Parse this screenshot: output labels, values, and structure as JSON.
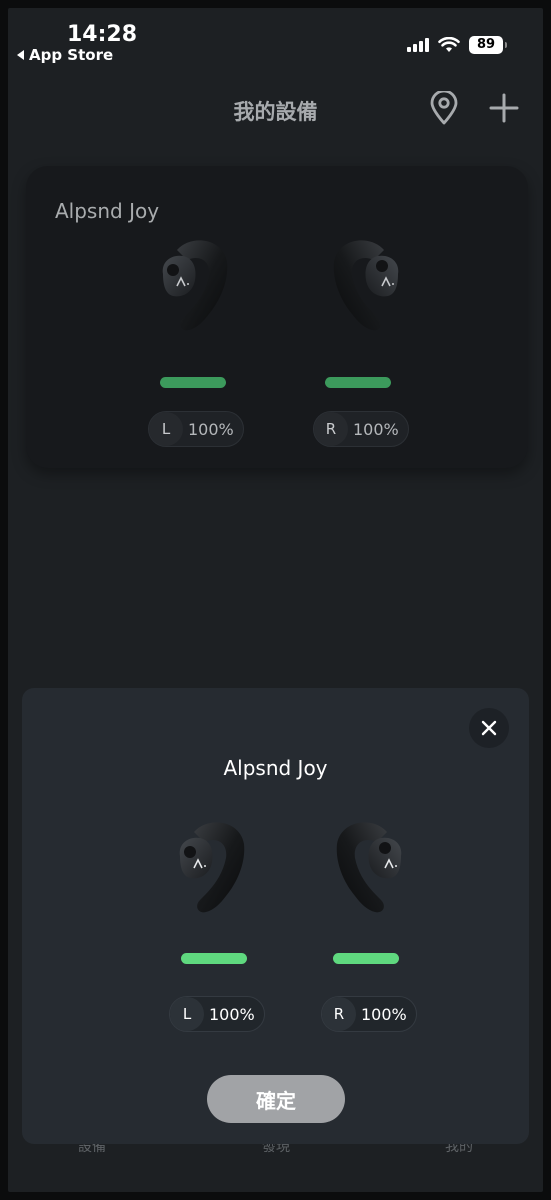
{
  "status_bar": {
    "time": "14:28",
    "back_app": "App Store",
    "battery_level": "89"
  },
  "header": {
    "title": "我的設備",
    "icons": [
      "location-pin-icon",
      "plus-icon"
    ]
  },
  "device_card": {
    "name": "Alpsnd Joy",
    "left": {
      "side": "L",
      "battery": "100%"
    },
    "right": {
      "side": "R",
      "battery": "100%"
    },
    "bar_color": "#3c9a5c"
  },
  "tabbar": {
    "items": [
      "設備",
      "發現",
      "我的"
    ]
  },
  "modal": {
    "title": "Alpsnd Joy",
    "left": {
      "side": "L",
      "battery": "100%"
    },
    "right": {
      "side": "R",
      "battery": "100%"
    },
    "bar_color": "#5fd97f",
    "confirm_label": "確定"
  },
  "colors": {
    "background": "#1d2023",
    "card": "#17191c",
    "modal": "#262b31",
    "confirm_button": "#a1a3a6"
  }
}
